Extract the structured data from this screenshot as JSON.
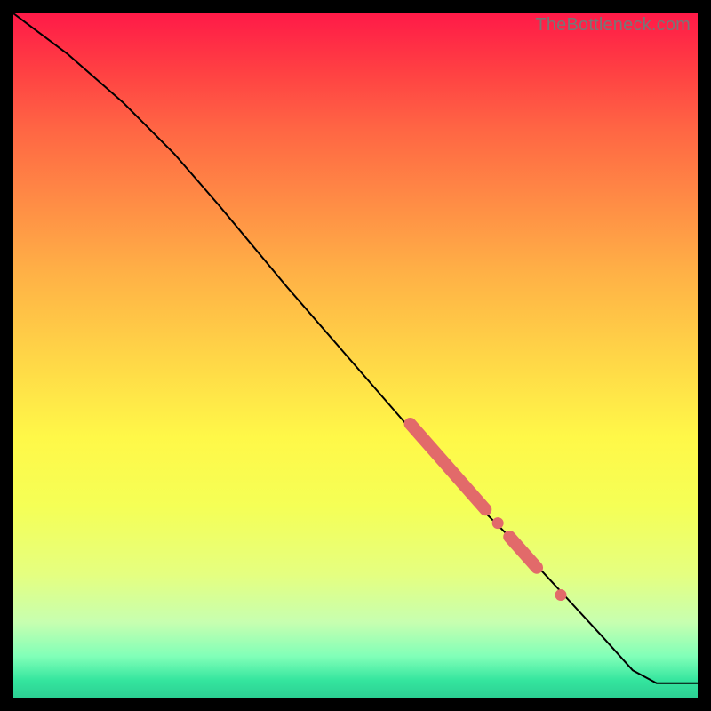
{
  "watermark": "TheBottleneck.com",
  "colors": {
    "marker": "#e26a6a",
    "curve": "#000000",
    "background_frame": "#000000"
  },
  "chart_data": {
    "type": "line",
    "title": "",
    "xlabel": "",
    "ylabel": "",
    "xlim": [
      0,
      100
    ],
    "ylim": [
      0,
      100
    ],
    "grid": false,
    "legend": false,
    "series": [
      {
        "name": "bottleneck-curve",
        "x": [
          0,
          8,
          16,
          23.5,
          30,
          40,
          50,
          60,
          68,
          74,
          80,
          86,
          90.5,
          94,
          100
        ],
        "y": [
          100,
          94,
          87,
          79.5,
          72,
          60,
          48.5,
          37,
          28,
          22,
          15.5,
          9,
          4,
          2.1,
          2.1
        ]
      }
    ],
    "highlight_segments": [
      {
        "x0": 58,
        "y0": 40,
        "x1": 69,
        "y1": 27.5
      },
      {
        "x0": 72.5,
        "y0": 23.5,
        "x1": 76.5,
        "y1": 19
      }
    ],
    "highlight_points": [
      {
        "x": 70.8,
        "y": 25.5
      },
      {
        "x": 80.0,
        "y": 15.0
      }
    ],
    "annotations": []
  }
}
